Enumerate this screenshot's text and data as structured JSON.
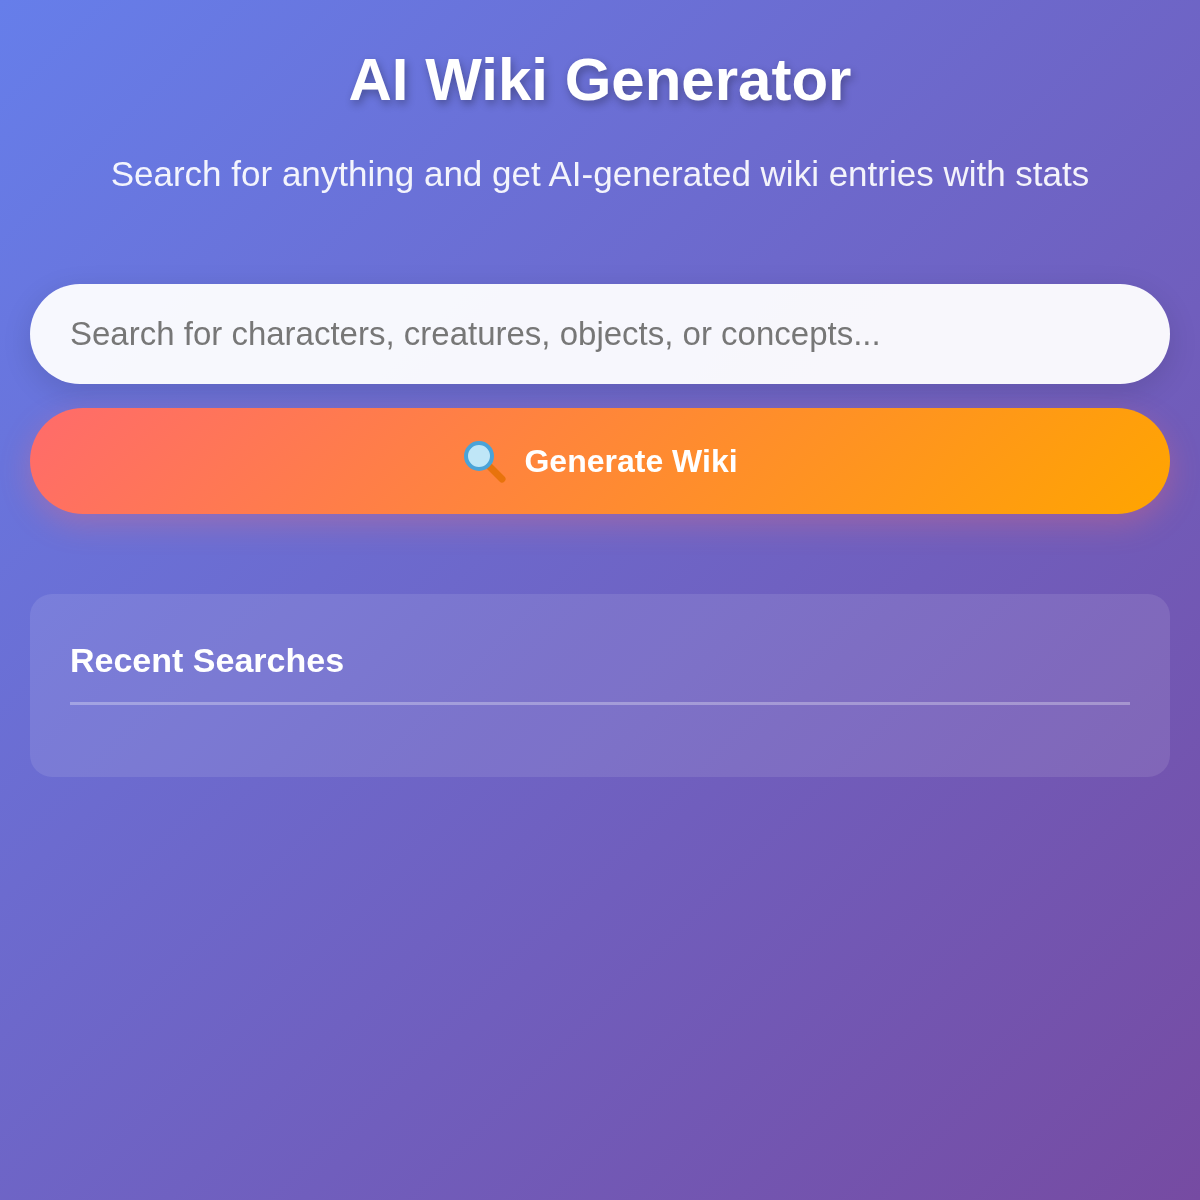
{
  "header": {
    "title": "AI Wiki Generator",
    "subtitle": "Search for anything and get AI-generated wiki entries with stats"
  },
  "search": {
    "placeholder": "Search for characters, creatures, objects, or concepts..."
  },
  "generate_button": {
    "label": "Generate Wiki"
  },
  "recent_searches": {
    "title": "Recent Searches"
  }
}
